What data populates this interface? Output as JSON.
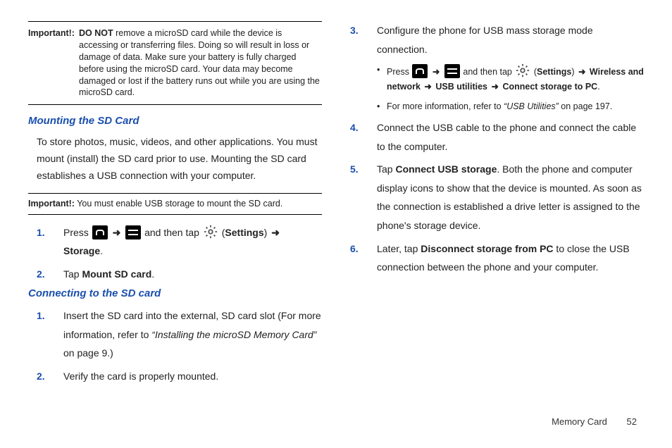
{
  "leftCol": {
    "important1": {
      "label": "Important!:",
      "pre": "DO NOT",
      "text": " remove a microSD card while the device is accessing or transferring files. Doing so will result in loss or damage of data. Make sure your battery is fully charged before using the microSD card. Your data may become damaged or lost if the battery runs out while you are using the microSD card."
    },
    "mountTitle": "Mounting the SD Card",
    "mountPara": "To store photos, music, videos, and other applications. You must mount (install) the SD card prior to use. Mounting the SD card establishes a USB connection with your computer.",
    "important2": {
      "label": "Important!:",
      "text": " You must enable USB storage to mount the SD card."
    },
    "steps1": {
      "n1": "1.",
      "t1a": "Press ",
      "t1b": " and then tap ",
      "settings": "Settings",
      "storage": "Storage",
      "n2": "2.",
      "t2a": "Tap ",
      "mountSd": "Mount SD card",
      "period": "."
    },
    "connectTitle": "Connecting to the SD card",
    "steps2": {
      "n1": "1.",
      "t1": "Insert the SD card into the external, SD card slot (For more information, refer to ",
      "ref": "“Installing the microSD Memory Card”",
      "t1b": " on page 9.)",
      "n2": "2.",
      "t2": "Verify the card is properly mounted."
    }
  },
  "rightCol": {
    "n3": "3.",
    "t3": "Configure the phone for USB mass storage mode connection.",
    "bullet1": {
      "pre": "Press ",
      "mid": " and then tap ",
      "settings": "Settings",
      "rest1": "Wireless and network",
      "rest2": "USB utilities",
      "rest3": "Connect storage to PC",
      "period": "."
    },
    "bullet2": {
      "pre": "For more information, refer to ",
      "ref": "“USB Utilities”",
      "post": "  on page 197."
    },
    "n4": "4.",
    "t4": "Connect the USB cable to the phone and connect the cable to the computer.",
    "n5": "5.",
    "t5a": "Tap ",
    "t5bold": "Connect USB storage",
    "t5b": ". Both the phone and computer display icons to show that the device is mounted. As soon as the connection is established a drive letter is assigned to the phone's storage device.",
    "n6": "6.",
    "t6a": "Later, tap ",
    "t6bold": "Disconnect storage from PC",
    "t6b": " to close the USB connection between the phone and your computer."
  },
  "footer": {
    "section": "Memory Card",
    "page": "52"
  },
  "glyphs": {
    "arrow": "➜"
  }
}
